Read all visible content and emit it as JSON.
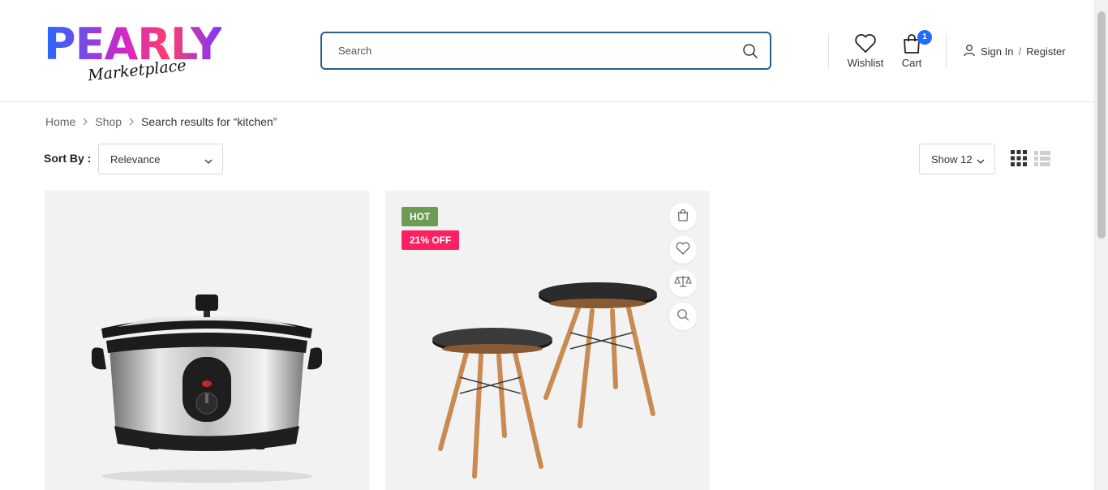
{
  "logo": {
    "main": "PEARLY",
    "sub": "Marketplace"
  },
  "search": {
    "placeholder": "Search"
  },
  "header": {
    "wishlist_label": "Wishlist",
    "cart_label": "Cart",
    "cart_count": "1",
    "signin_label": "Sign In",
    "separator": "/",
    "register_label": "Register"
  },
  "breadcrumb": {
    "home": "Home",
    "shop": "Shop",
    "current": "Search results for “kitchen”"
  },
  "sort": {
    "label": "Sort By :",
    "selected": "Relevance"
  },
  "show": {
    "selected": "Show 12"
  },
  "products": [
    {
      "icon": "slow-cooker-image"
    },
    {
      "icon": "side-tables-image",
      "badge_hot": "HOT",
      "badge_sale": "21% OFF"
    }
  ],
  "colors": {
    "accent": "#1e6cff",
    "search_border": "#2c5f8a",
    "hot_badge": "#6d9b54",
    "sale_badge": "#ff2063",
    "card_bg": "#f2f2f2"
  }
}
